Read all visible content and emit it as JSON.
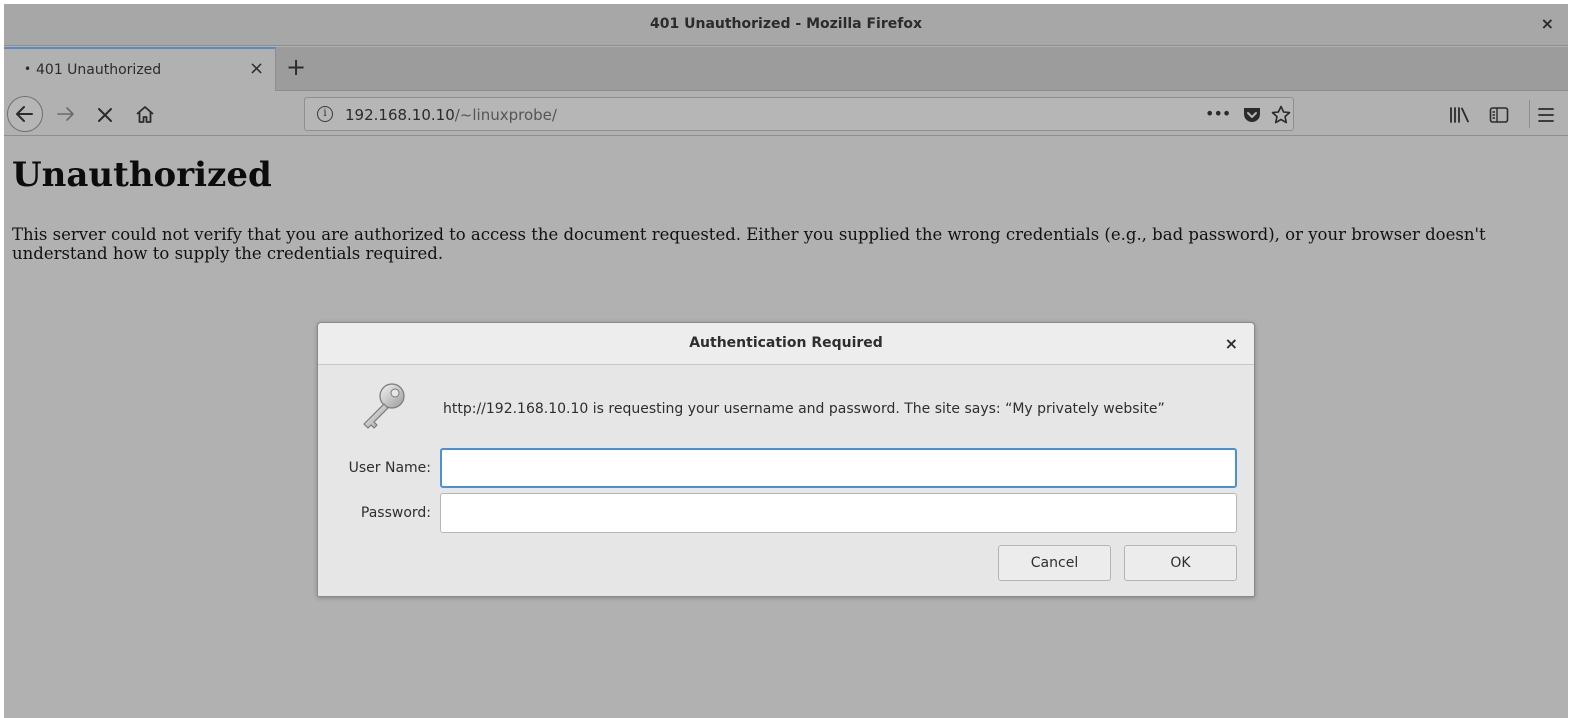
{
  "window": {
    "title": "401 Unauthorized - Mozilla Firefox",
    "close_label": "×"
  },
  "tabs": [
    {
      "indicator": "•",
      "label": "401 Unauthorized",
      "close_label": "×"
    }
  ],
  "new_tab_label": "+",
  "navbar": {
    "back_icon": "arrow-left-icon",
    "forward_icon": "arrow-right-icon",
    "stop_icon": "stop-icon",
    "home_icon": "home-icon",
    "url_host": "192.168.10.10",
    "url_path": "/~linuxprobe/",
    "page_actions_label": "•••",
    "library_icon": "library-icon",
    "sidebar_icon": "sidebar-icon",
    "menu_icon": "hamburger-menu-icon"
  },
  "page": {
    "heading": "Unauthorized",
    "body": "This server could not verify that you are authorized to access the document requested. Either you supplied the wrong credentials (e.g., bad password), or your browser doesn't understand how to supply the credentials required."
  },
  "dialog": {
    "title": "Authentication Required",
    "close_label": "×",
    "message": "http://192.168.10.10 is requesting your username and password. The site says: “My privately website”",
    "username_label": "User Name:",
    "username_value": "",
    "password_label": "Password:",
    "password_value": "",
    "cancel_label": "Cancel",
    "ok_label": "OK"
  },
  "colors": {
    "tab_accent": "#5a8bc2",
    "focus_ring": "#4a90d9",
    "page_background": "#b1b1b1"
  }
}
